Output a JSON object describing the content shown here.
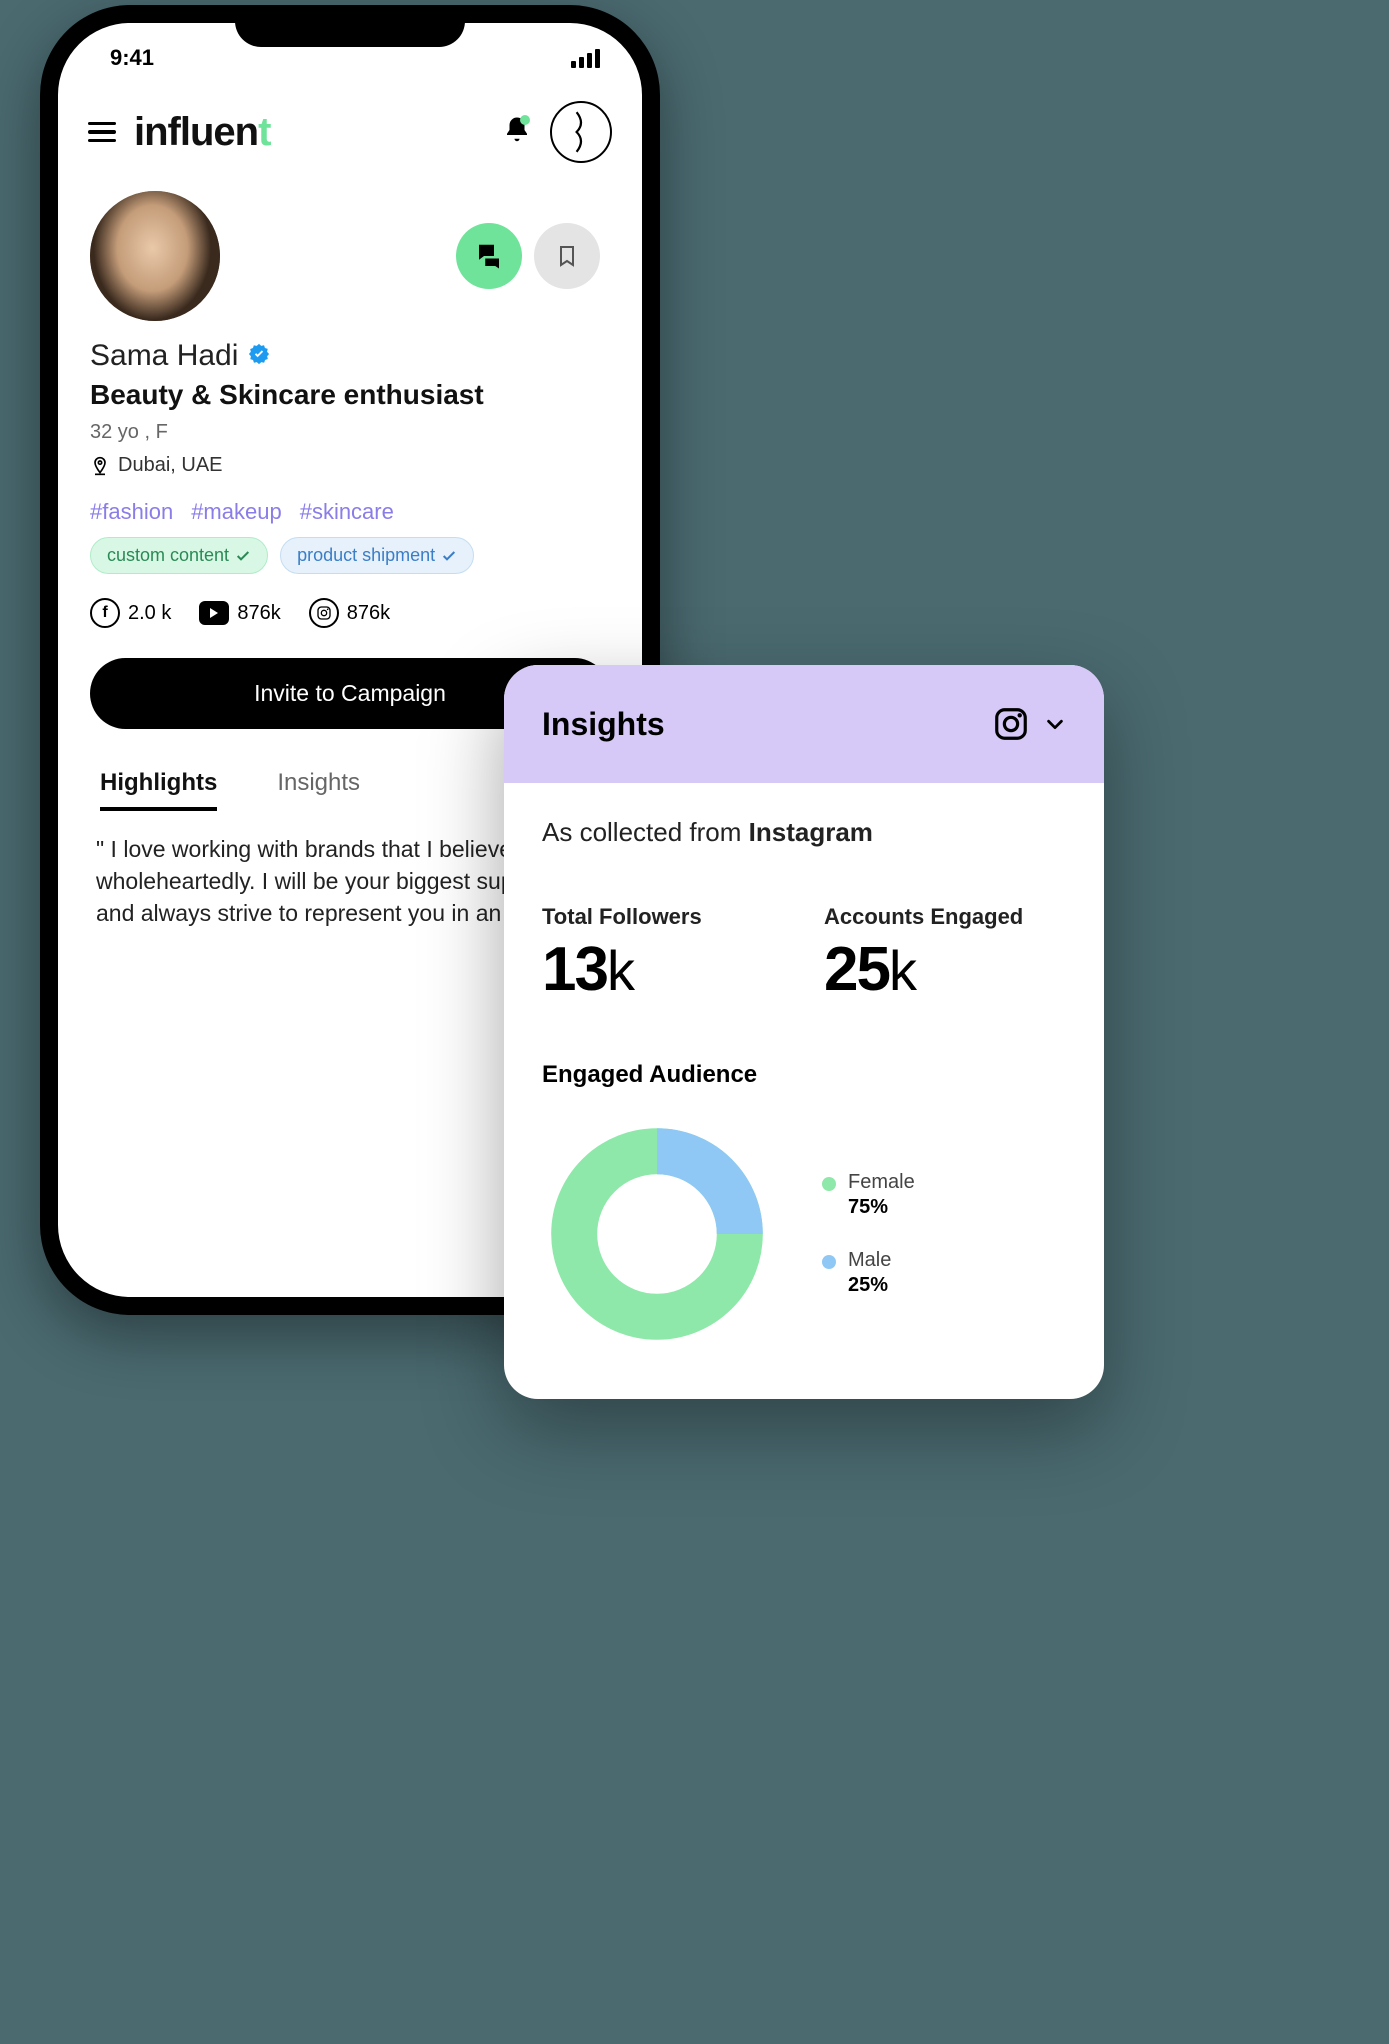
{
  "status_bar": {
    "time": "9:41"
  },
  "header": {
    "brand": "influent"
  },
  "profile": {
    "name": "Sama Hadi",
    "title": "Beauty & Skincare enthusiast",
    "age_gender": "32 yo , F",
    "location": "Dubai, UAE",
    "hashtags": [
      "#fashion",
      "#makeup",
      "#skincare"
    ],
    "badges": {
      "custom_content": "custom content",
      "product_shipment": "product shipment"
    },
    "social": {
      "facebook": "2.0 k",
      "youtube": "876k",
      "instagram": "876k"
    },
    "invite_label": "Invite to Campaign",
    "tabs": {
      "highlights": "Highlights",
      "insights": "Insights"
    },
    "quote": "\" I love working with brands that I believe in wholeheartedly. I will be your biggest supporter and always strive to  represent you in an"
  },
  "insights": {
    "panel_title": "Insights",
    "collected_prefix": "As collected from ",
    "collected_source": "Instagram",
    "followers_label": "Total Followers",
    "followers_value": "13",
    "followers_unit": "k",
    "engaged_label": "Accounts Engaged",
    "engaged_value": "25",
    "engaged_unit": "k",
    "audience_title": "Engaged Audience",
    "legend": {
      "female_label": "Female",
      "female_value": "75%",
      "male_label": "Male",
      "male_value": "25%"
    }
  },
  "chart_data": {
    "type": "pie",
    "title": "Engaged Audience",
    "series": [
      {
        "name": "Female",
        "value": 75,
        "color": "#8ee8a9"
      },
      {
        "name": "Male",
        "value": 25,
        "color": "#8fc8f5"
      }
    ]
  }
}
